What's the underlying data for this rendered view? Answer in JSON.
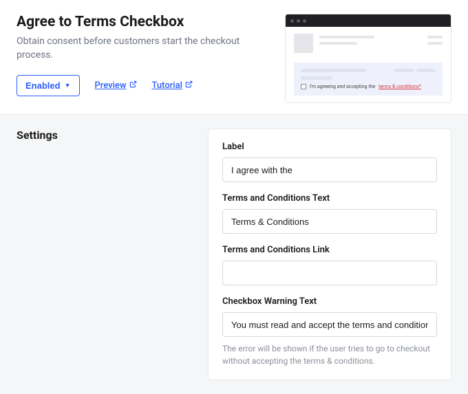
{
  "header": {
    "title": "Agree to Terms Checkbox",
    "subtitle": "Obtain consent before customers start the checkout process.",
    "enabled_label": "Enabled",
    "preview_label": "Preview",
    "tutorial_label": "Tutorial"
  },
  "preview_mock": {
    "consent_prefix": "I'm agreeing and accepting the",
    "consent_link": "terms & conditions*"
  },
  "settings": {
    "section_title": "Settings",
    "label_field": {
      "label": "Label",
      "value": "I agree with the"
    },
    "terms_text_field": {
      "label": "Terms and Conditions Text",
      "value": "Terms & Conditions"
    },
    "terms_link_field": {
      "label": "Terms and Conditions Link",
      "value": ""
    },
    "warning_field": {
      "label": "Checkbox Warning Text",
      "value": "You must read and accept the terms and conditions to complete checkout",
      "help": "The error will be shown if the user tries to go to checkout without accepting the terms & conditions."
    }
  }
}
